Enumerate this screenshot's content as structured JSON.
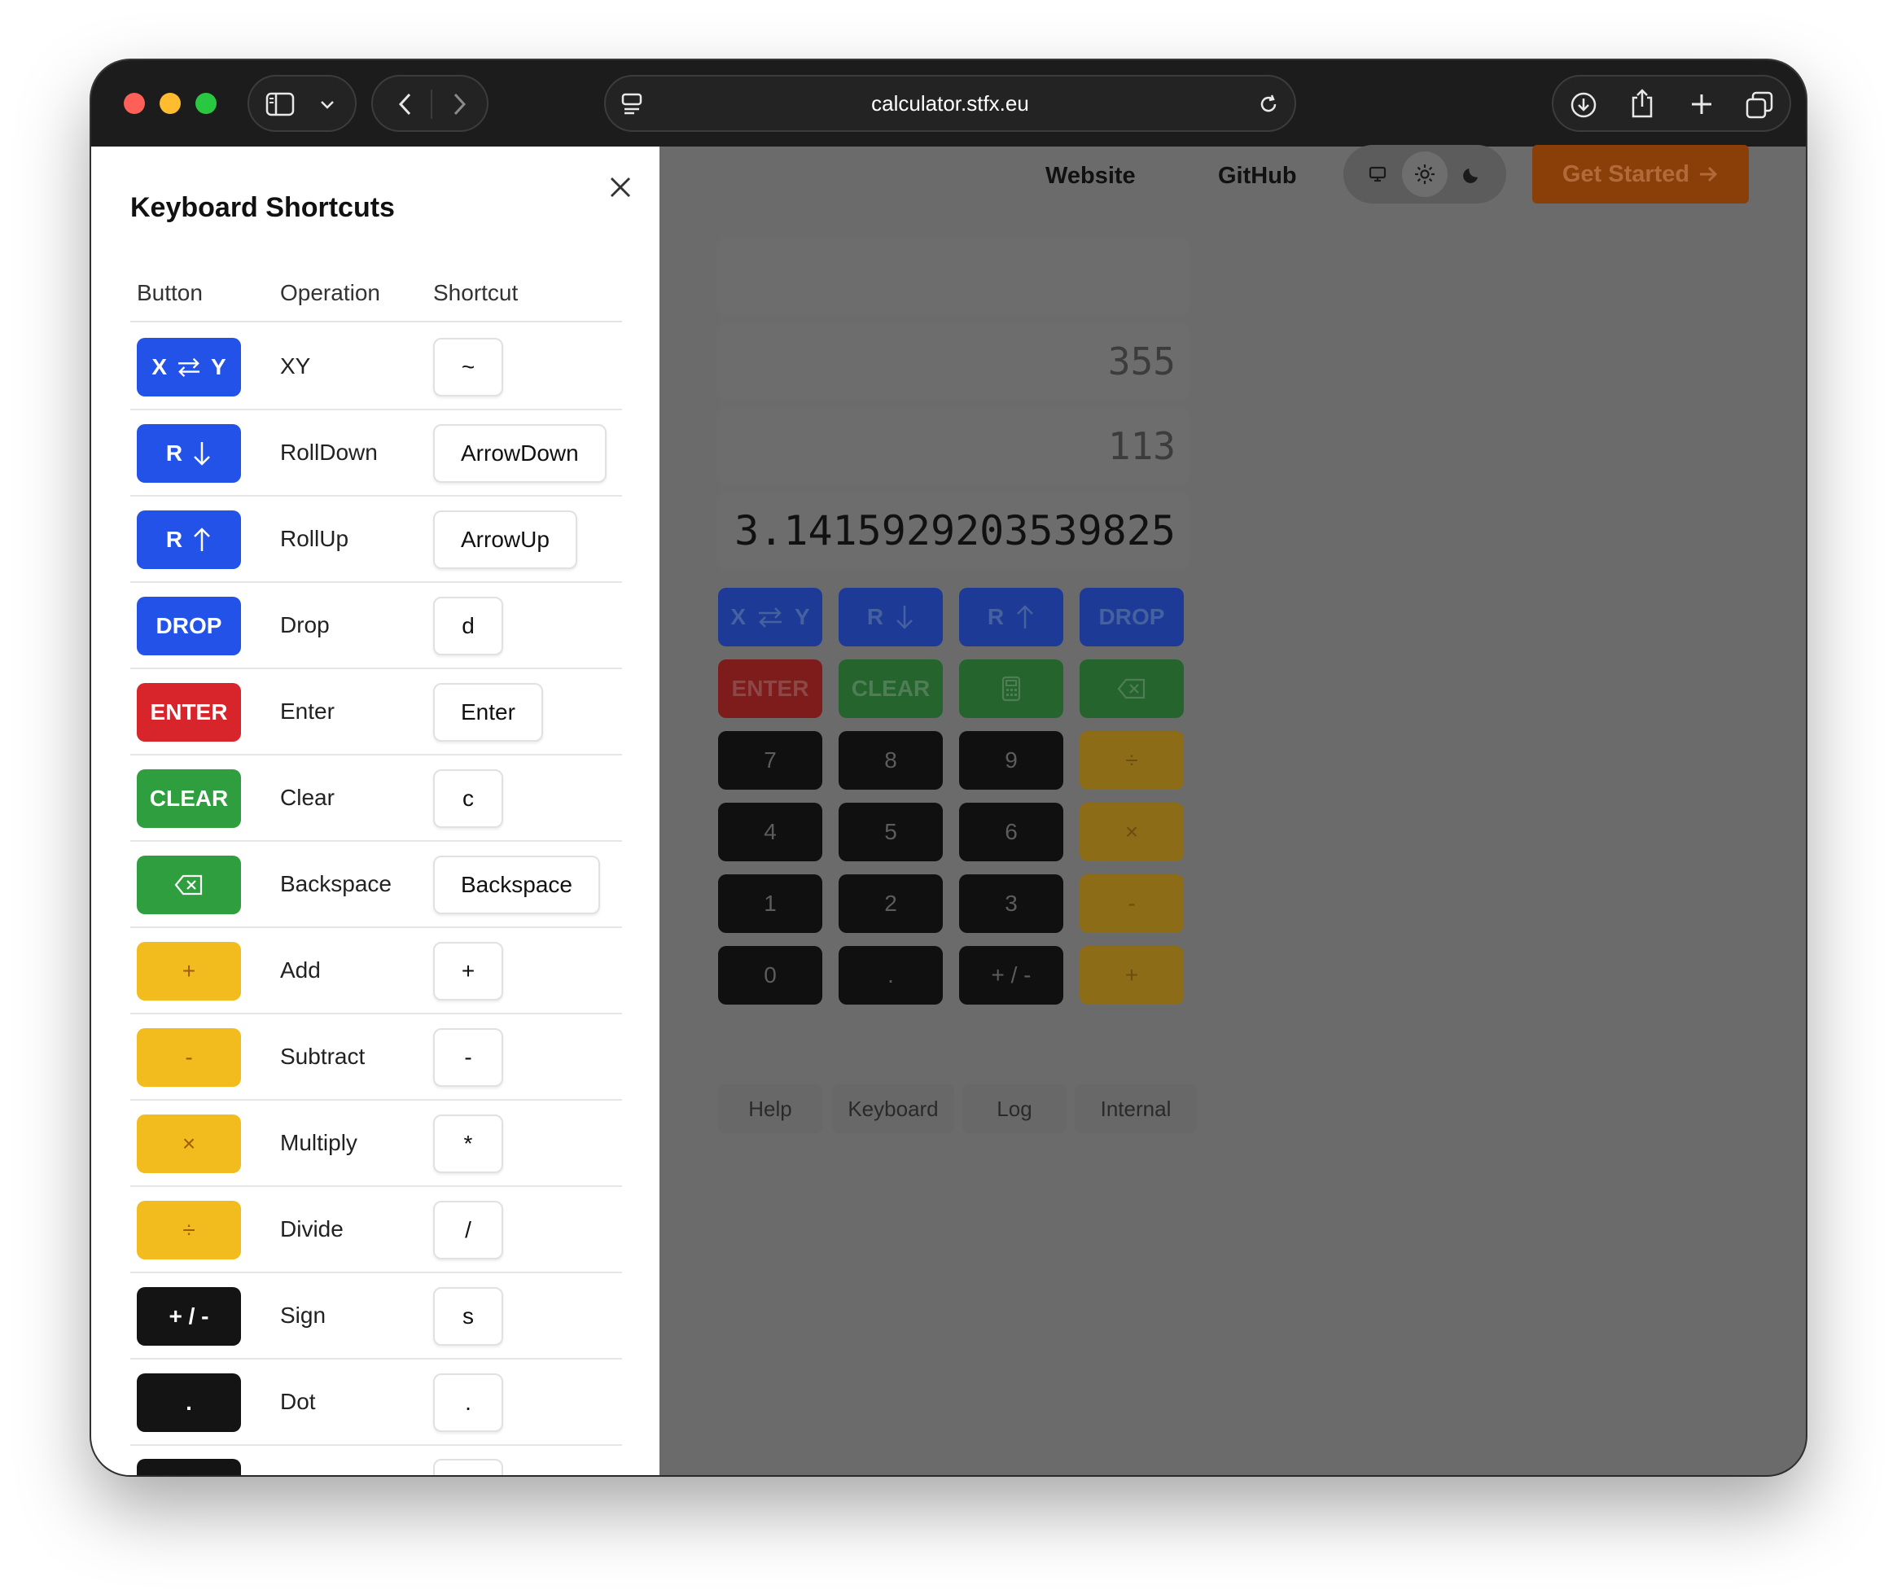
{
  "browser": {
    "url": "calculator.stfx.eu"
  },
  "panel": {
    "title": "Keyboard Shortcuts",
    "headers": {
      "button": "Button",
      "operation": "Operation",
      "shortcut": "Shortcut"
    },
    "rows": [
      {
        "button": "X ⇄ Y",
        "operation": "XY",
        "shortcut": "~",
        "color": "blue"
      },
      {
        "button": "R ↓",
        "operation": "RollDown",
        "shortcut": "ArrowDown",
        "color": "blue"
      },
      {
        "button": "R ↑",
        "operation": "RollUp",
        "shortcut": "ArrowUp",
        "color": "blue"
      },
      {
        "button": "DROP",
        "operation": "Drop",
        "shortcut": "d",
        "color": "blue"
      },
      {
        "button": "ENTER",
        "operation": "Enter",
        "shortcut": "Enter",
        "color": "red"
      },
      {
        "button": "CLEAR",
        "operation": "Clear",
        "shortcut": "c",
        "color": "green"
      },
      {
        "button": "⌫",
        "operation": "Backspace",
        "shortcut": "Backspace",
        "color": "green"
      },
      {
        "button": "+",
        "operation": "Add",
        "shortcut": "+",
        "color": "yellow"
      },
      {
        "button": "-",
        "operation": "Subtract",
        "shortcut": "-",
        "color": "yellow"
      },
      {
        "button": "×",
        "operation": "Multiply",
        "shortcut": "*",
        "color": "yellow"
      },
      {
        "button": "÷",
        "operation": "Divide",
        "shortcut": "/",
        "color": "yellow"
      },
      {
        "button": "+ / -",
        "operation": "Sign",
        "shortcut": "s",
        "color": "black"
      },
      {
        "button": ".",
        "operation": "Dot",
        "shortcut": ".",
        "color": "black"
      }
    ]
  },
  "nav": {
    "website": "Website",
    "github": "GitHub",
    "get_started": "Get Started",
    "theme_options": [
      "system",
      "light",
      "dark"
    ],
    "active_theme": "light"
  },
  "calculator": {
    "stack": [
      "",
      "355",
      "113",
      "3.141592920353982 5"
    ],
    "keys": {
      "xy": "X ⇄ Y",
      "rolldown": "R",
      "rollup": "R",
      "drop": "DROP",
      "enter": "ENTER",
      "clear": "CLEAR",
      "n7": "7",
      "n8": "8",
      "n9": "9",
      "div": "÷",
      "n4": "4",
      "n5": "5",
      "n6": "6",
      "mul": "×",
      "n1": "1",
      "n2": "2",
      "n3": "3",
      "sub": "-",
      "n0": "0",
      "dot": ".",
      "sign": "+ / -",
      "add": "+"
    },
    "footer": [
      "Help",
      "Keyboard",
      "Log",
      "Internal"
    ]
  },
  "colors": {
    "blue": "#2252e8",
    "red": "#d8252b",
    "green": "#2f9e3e",
    "yellow": "#f3bc1e",
    "black": "#141414",
    "accent": "#c2570c"
  }
}
